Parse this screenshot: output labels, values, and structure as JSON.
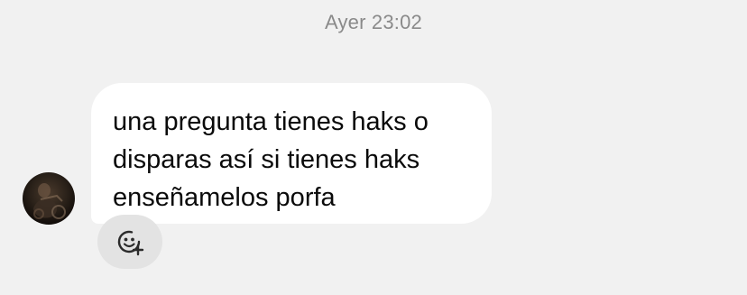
{
  "conversation": {
    "timestamp": "Ayer 23:02"
  },
  "message": {
    "lines": [
      "una pregunta tienes haks o",
      "disparas así si tienes haks",
      "enseñamelos porfa"
    ],
    "bubble_color": "#ffffff",
    "text_color": "#0a0a0a"
  },
  "reaction": {
    "icon": "add-reaction-icon"
  },
  "colors": {
    "background": "#f1f1f1",
    "timestamp": "#8a8a8a",
    "reaction_button": "#e3e3e3"
  }
}
